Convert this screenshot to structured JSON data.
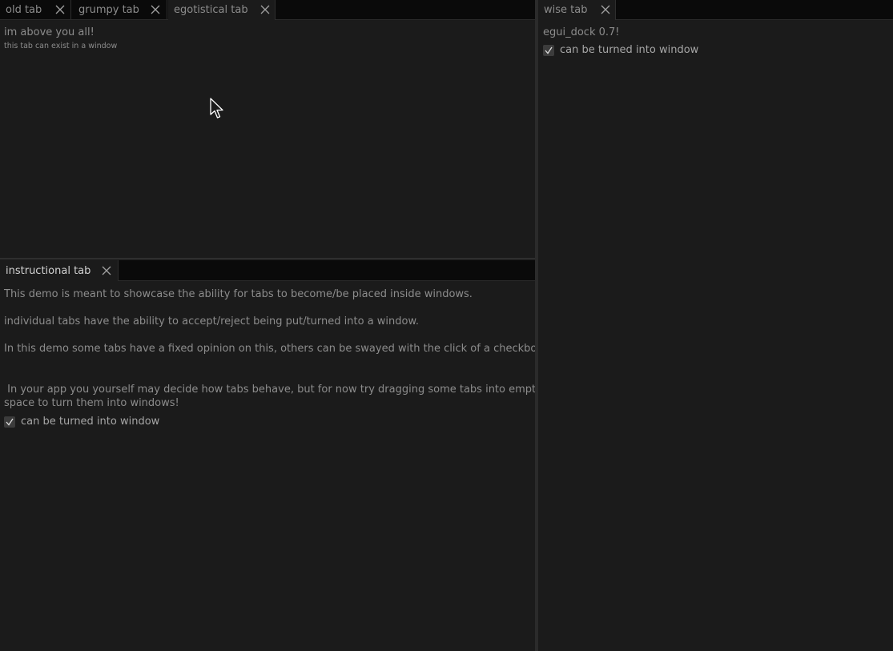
{
  "top_left_pane": {
    "tabs": [
      {
        "label": "old tab"
      },
      {
        "label": "grumpy tab"
      },
      {
        "label": "egotistical tab"
      }
    ],
    "content": {
      "heading": "im above you all!",
      "subtext": "this tab can exist in a window"
    }
  },
  "bottom_left_pane": {
    "tabs": [
      {
        "label": "instructional tab"
      }
    ],
    "content": {
      "line1": "This demo is meant to showcase the ability for tabs to become/be placed inside windows.",
      "line2": "individual tabs have the ability to accept/reject being put/turned into a window.",
      "line3": "In this demo some tabs have a fixed opinion on this, others can be swayed with the click of a checkbox.",
      "line4a": " In your app you yourself may decide how tabs behave, but for now try dragging some tabs into empty",
      "line4b": "space to turn them into windows!",
      "checkbox_label": "can be turned into window",
      "checkbox_checked": true
    }
  },
  "right_pane": {
    "tabs": [
      {
        "label": "wise tab"
      }
    ],
    "content": {
      "heading": "egui_dock 0.7!",
      "checkbox_label": "can be turned into window",
      "checkbox_checked": true
    }
  },
  "colors": {
    "background": "#1b1b1b",
    "tabbar": "#0a0a0a",
    "text": "#8c8c8c",
    "active_text": "#d2d2d2"
  }
}
